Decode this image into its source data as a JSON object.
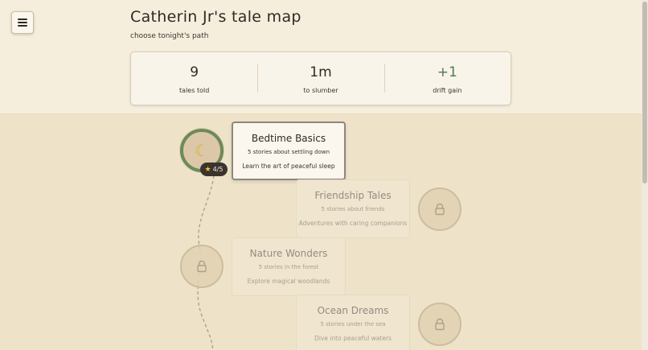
{
  "header": {
    "title": "Catherin Jr's tale map",
    "subtitle": "choose tonight's path"
  },
  "stats": [
    {
      "value": "9",
      "label": "tales told"
    },
    {
      "value": "1m",
      "label": "to slumber"
    },
    {
      "value": "+1",
      "label": "drift gain"
    }
  ],
  "lessons": [
    {
      "title": "Bedtime Basics",
      "line1": "5 stories about settling down",
      "line2": "Learn the art of peaceful sleep",
      "progress": "4/5",
      "state": "active"
    },
    {
      "title": "Friendship Tales",
      "line1": "5 stories about friends",
      "line2": "Adventures with caring companions",
      "state": "locked"
    },
    {
      "title": "Nature Wonders",
      "line1": "5 stories in the forest",
      "line2": "Explore magical woodlands",
      "state": "locked"
    },
    {
      "title": "Ocean Dreams",
      "line1": "5 stories under the sea",
      "line2": "Dive into peaceful waters",
      "state": "locked"
    }
  ],
  "icons": {
    "menu": "hamburger-icon",
    "active_node": "moon-icon",
    "locked_node": "lock-icon",
    "badge": "star-icon"
  },
  "colors": {
    "progress_ring": "#6b8a5a",
    "gain": "#4f7a52"
  }
}
